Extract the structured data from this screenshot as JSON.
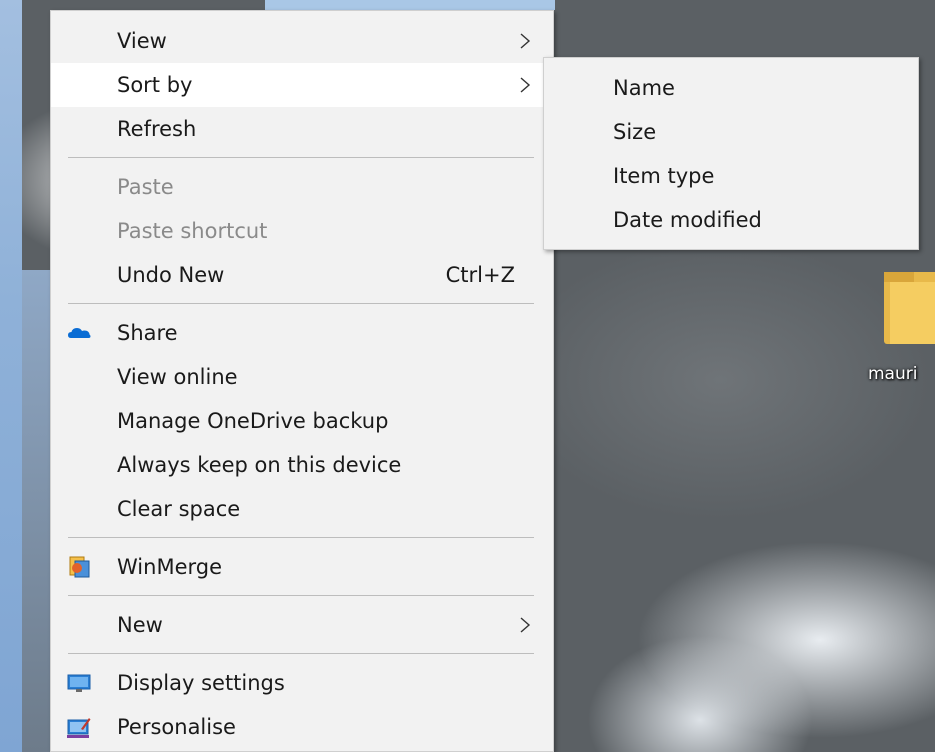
{
  "desktop": {
    "folder_label": "mauri",
    "folder_icon": "folder-icon"
  },
  "context_menu": {
    "view": {
      "label": "View",
      "icon": "chevron-right-icon"
    },
    "sort_by": {
      "label": "Sort by",
      "icon": "chevron-right-icon"
    },
    "refresh": {
      "label": "Refresh"
    },
    "paste": {
      "label": "Paste",
      "disabled": true
    },
    "paste_shortcut": {
      "label": "Paste shortcut",
      "disabled": true
    },
    "undo_new": {
      "label": "Undo New",
      "shortcut": "Ctrl+Z"
    },
    "share": {
      "label": "Share",
      "icon": "onedrive-cloud-icon"
    },
    "view_online": {
      "label": "View online"
    },
    "manage_onedrive_backup": {
      "label": "Manage OneDrive backup"
    },
    "always_keep": {
      "label": "Always keep on this device"
    },
    "clear_space": {
      "label": "Clear space"
    },
    "winmerge": {
      "label": "WinMerge",
      "icon": "winmerge-icon"
    },
    "new": {
      "label": "New",
      "icon": "chevron-right-icon"
    },
    "display_settings": {
      "label": "Display settings",
      "icon": "display-settings-icon"
    },
    "personalise": {
      "label": "Personalise",
      "icon": "personalise-icon"
    }
  },
  "sort_submenu": {
    "items": [
      {
        "label": "Name"
      },
      {
        "label": "Size"
      },
      {
        "label": "Item type"
      },
      {
        "label": "Date modified"
      }
    ]
  },
  "colors": {
    "menu_bg": "#f2f2f2",
    "hover_bg": "#ffffff",
    "disabled_text": "#8a8a8a",
    "onedrive_blue": "#0a6cd4"
  }
}
